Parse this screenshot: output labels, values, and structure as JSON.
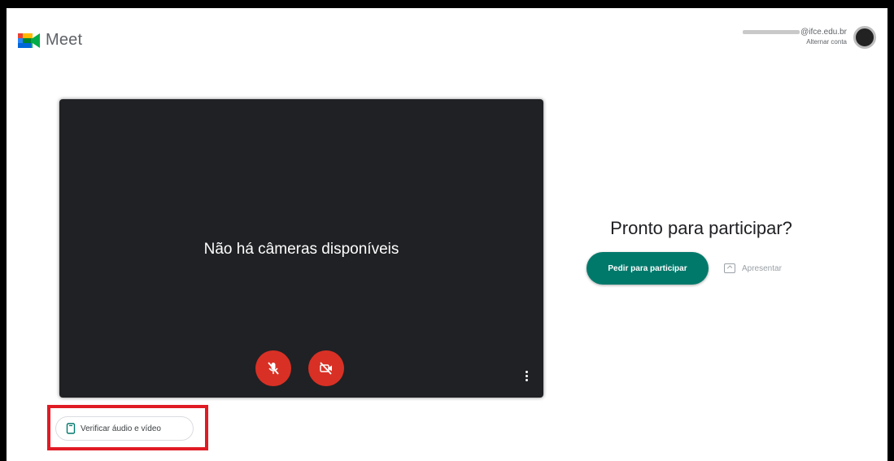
{
  "header": {
    "app_name": "Meet",
    "account_email": "@ifce.edu.br",
    "account_switch_label": "Alternar conta"
  },
  "preview": {
    "status_message": "Não há câmeras disponíveis",
    "mic_icon": "mic-off-icon",
    "camera_icon": "camera-off-icon"
  },
  "join_panel": {
    "title": "Pronto para participar?",
    "join_label": "Pedir para participar",
    "present_label": "Apresentar"
  },
  "check_av": {
    "label": "Verificar áudio e vídeo"
  },
  "colors": {
    "join_button": "#00796b",
    "control_off": "#d93025",
    "highlight": "#e01b24",
    "preview_bg": "#202124"
  }
}
